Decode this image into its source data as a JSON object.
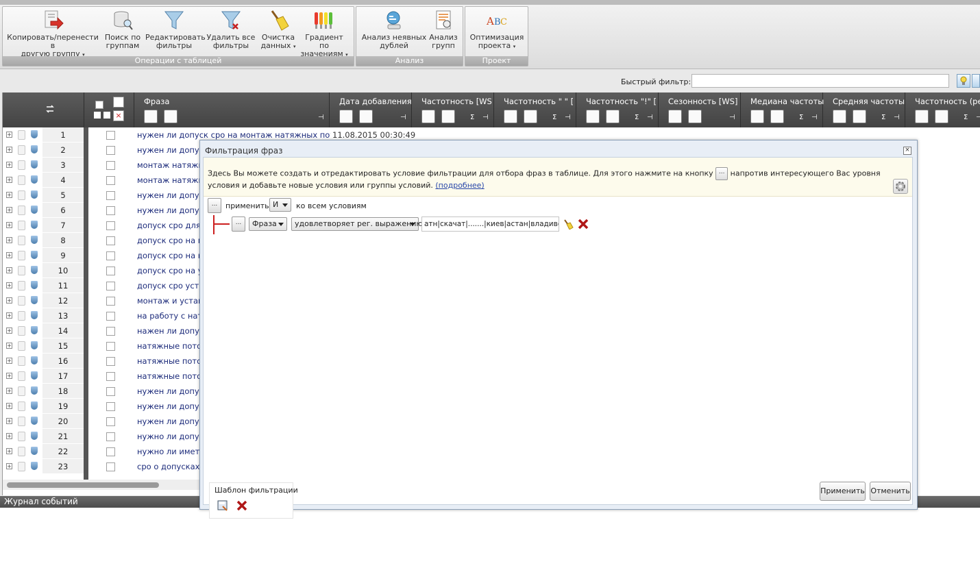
{
  "ribbon": {
    "groups": [
      {
        "label": "Операции с таблицей"
      },
      {
        "label": "Анализ"
      },
      {
        "label": "Проект"
      }
    ],
    "buttons": [
      {
        "line1": "Копировать/перенести в",
        "line2": "другую группу",
        "dropdown": true,
        "icon": "copy-move-icon"
      },
      {
        "line1": "Поиск по",
        "line2": "группам",
        "dropdown": false,
        "icon": "group-search-icon"
      },
      {
        "line1": "Редактировать",
        "line2": "фильтры",
        "dropdown": false,
        "icon": "funnel-icon"
      },
      {
        "line1": "Удалить все",
        "line2": "фильтры",
        "dropdown": false,
        "icon": "funnel-delete-icon"
      },
      {
        "line1": "Очистка",
        "line2": "данных",
        "dropdown": true,
        "icon": "broom-icon"
      },
      {
        "line1": "Градиент по",
        "line2": "значениям",
        "dropdown": true,
        "icon": "gradient-icon"
      },
      {
        "line1": "Анализ неявных",
        "line2": "дублей",
        "dropdown": false,
        "icon": "duplicates-icon"
      },
      {
        "line1": "Анализ",
        "line2": "групп",
        "dropdown": false,
        "icon": "group-analysis-icon"
      },
      {
        "line1": "Оптимизация",
        "line2": "проекта",
        "dropdown": true,
        "icon": "abc-spellcheck-icon"
      }
    ],
    "dropdown_glyph": "▾"
  },
  "quick_filter": {
    "label": "Быстрый фильтр:",
    "value": ""
  },
  "table": {
    "columns": [
      {
        "title": "Фраза"
      },
      {
        "title": "Дата добавления"
      },
      {
        "title": "Частотность [WS"
      },
      {
        "title": "Частотность \" \" ["
      },
      {
        "title": "Частотность \"!\" ["
      },
      {
        "title": "Сезонность [WS]"
      },
      {
        "title": "Медиана частоты"
      },
      {
        "title": "Средняя частоты"
      },
      {
        "title": "Частотность (рег"
      }
    ],
    "sum_glyph": "Σ",
    "pin_glyph": "⊣",
    "expand_glyph": "+",
    "rows": [
      {
        "n": "1",
        "phrase": "нужен ли допуск сро на монтаж натяжных потолк",
        "date": "11.08.2015 00:30:49"
      },
      {
        "n": "2",
        "phrase": "нужен ли допуск",
        "date": ""
      },
      {
        "n": "3",
        "phrase": "монтаж натяжны",
        "date": ""
      },
      {
        "n": "4",
        "phrase": "монтаж натяжны",
        "date": ""
      },
      {
        "n": "5",
        "phrase": "нужен ли допуск",
        "date": ""
      },
      {
        "n": "6",
        "phrase": "нужен ли допуск",
        "date": ""
      },
      {
        "n": "7",
        "phrase": "допуск сро для н",
        "date": ""
      },
      {
        "n": "8",
        "phrase": "допуск сро на мо",
        "date": ""
      },
      {
        "n": "9",
        "phrase": "допуск сро на на",
        "date": ""
      },
      {
        "n": "10",
        "phrase": "допуск сро на ус",
        "date": ""
      },
      {
        "n": "11",
        "phrase": "допуск сро устан",
        "date": ""
      },
      {
        "n": "12",
        "phrase": "монтаж и устано",
        "date": ""
      },
      {
        "n": "13",
        "phrase": "на работу с натя",
        "date": ""
      },
      {
        "n": "14",
        "phrase": "нажен ли допуск",
        "date": ""
      },
      {
        "n": "15",
        "phrase": "натяжные потол",
        "date": ""
      },
      {
        "n": "16",
        "phrase": "натяжные потол",
        "date": ""
      },
      {
        "n": "17",
        "phrase": "натяжные потол",
        "date": ""
      },
      {
        "n": "18",
        "phrase": "нужен ли допуск",
        "date": ""
      },
      {
        "n": "19",
        "phrase": "нужен ли допуск",
        "date": ""
      },
      {
        "n": "20",
        "phrase": "нужен ли допуск",
        "date": ""
      },
      {
        "n": "21",
        "phrase": "нужно ли допуск",
        "date": ""
      },
      {
        "n": "22",
        "phrase": "нужно ли иметь",
        "date": ""
      },
      {
        "n": "23",
        "phrase": "сро о допусках к",
        "date": ""
      }
    ]
  },
  "journal": {
    "title": "Журнал событий"
  },
  "dialog": {
    "title": "Фильтрация фраз",
    "close_glyph": "×",
    "info_part1": "Здесь Вы можете создать и отредактировать условие фильтрации для отбора фраз в таблице. Для этого нажмите на кнопку",
    "info_part2": "напротив интересующего Вас уровня условия и добавьте новые условия или группы условий.",
    "info_link": "(подробнее)",
    "ellipsis": "...",
    "apply_label": "применить",
    "logic_value": "И",
    "to_all_label": "ко всем условиям",
    "condition": {
      "field": "Фраза",
      "operator": "удовлетворяет рег. выражению",
      "value": "атн|скачат|.......|киев|астан|владивосток"
    },
    "template_label": "Шаблон фильтрации",
    "apply_button": "Применить",
    "cancel_button": "Отменить"
  },
  "colors": {
    "header_bg": "#4d4d4d",
    "phrase_text": "#1b2a7a",
    "delete_red": "#b01818",
    "condition_line": "#cc1f1f",
    "info_bg": "#fdfbec"
  }
}
